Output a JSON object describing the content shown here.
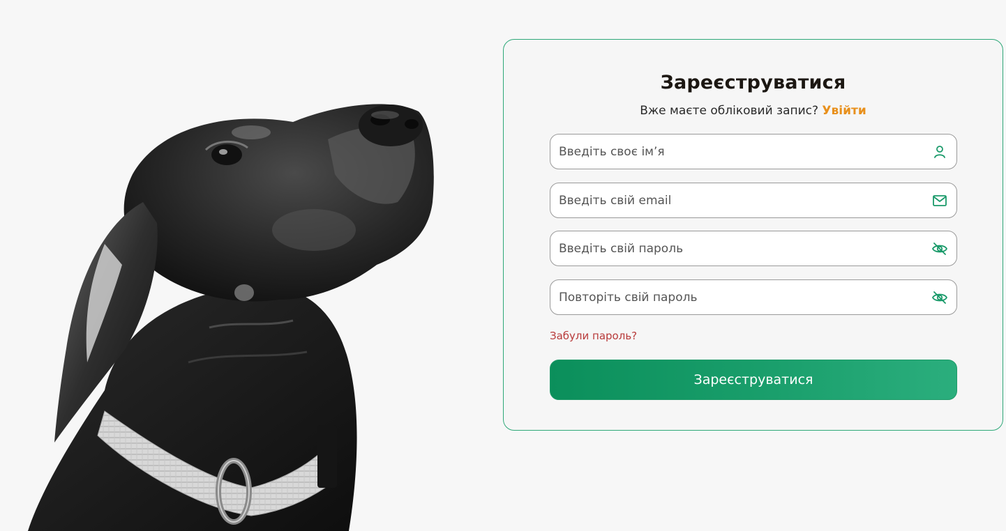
{
  "form": {
    "title": "Зареєструватися",
    "subtitle_text": "Вже маєте обліковий запис? ",
    "login_link": "Увійти",
    "fields": {
      "name": {
        "placeholder": "Введіть своє ім’я",
        "icon": "user-icon"
      },
      "email": {
        "placeholder": "Введіть свій email",
        "icon": "mail-icon"
      },
      "password": {
        "placeholder": "Введіть свій пароль",
        "icon": "eye-off-icon"
      },
      "password_repeat": {
        "placeholder": "Повторіть свій пароль",
        "icon": "eye-off-icon"
      }
    },
    "forgot_link": "Забули пароль?",
    "submit_label": "Зареєструватися"
  },
  "colors": {
    "accent_green": "#0b8f5b",
    "card_border": "#2ea878",
    "login_link": "#e8901c",
    "forgot_link": "#b83a3a",
    "background": "#f7f7f7"
  }
}
